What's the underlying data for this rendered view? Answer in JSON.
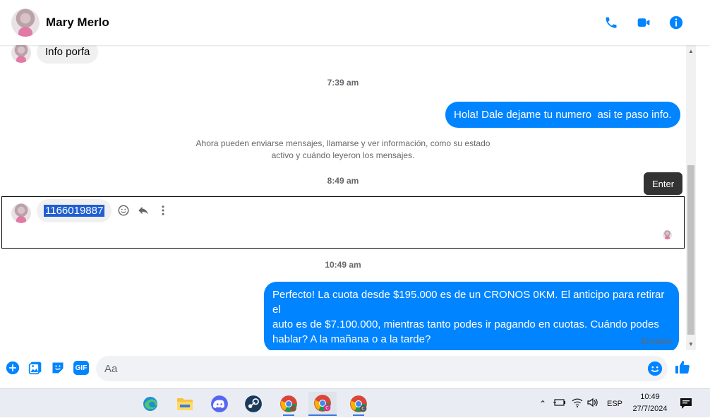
{
  "header": {
    "contact_name": "Mary Merlo",
    "actions": [
      "phone-icon",
      "video-icon",
      "info-icon"
    ],
    "accent": "#0084ff"
  },
  "messages": {
    "first_incoming": "Info porfa",
    "ts1": "7:39 am",
    "outgoing1": "Hola! Dale dejame tu numero  asi te paso info.",
    "system_line1": "Ahora pueden enviarse mensajes, llamarse y ver información, como su estado",
    "system_line2": "activo y cuándo leyeron los mensajes.",
    "ts2": "8:49 am",
    "incoming_number": "1166019887",
    "tooltip": "Enter",
    "ts3": "10:49 am",
    "outgoing2_line1": "Perfecto! La cuota desde $195.000 es de un CRONOS 0KM. El anticipo para retirar el",
    "outgoing2_line2": "auto es de $7.100.000, mientras tanto podes ir pagando en cuotas. Cuándo podes",
    "outgoing2_line3": "hablar? A la mañana o a la tarde?",
    "status": "Enviado"
  },
  "composer": {
    "placeholder": "Aa",
    "gif_label": "GIF",
    "icons": [
      "plus-icon",
      "image-icon",
      "sticker-icon",
      "gif-icon",
      "emoji-icon",
      "like-icon"
    ]
  },
  "taskbar": {
    "apps": [
      "edge-icon",
      "file-explorer-icon",
      "discord-icon",
      "steam-icon",
      "chrome-icon",
      "chrome-profile-icon",
      "chrome-profile-icon"
    ],
    "language": "ESP",
    "time": "10:49",
    "date": "27/7/2024"
  }
}
